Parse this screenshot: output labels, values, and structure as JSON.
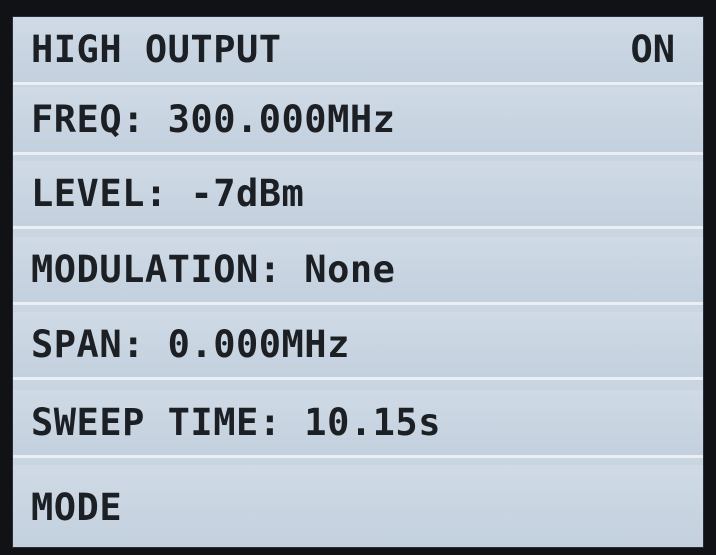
{
  "menu": {
    "rows": [
      {
        "label": "HIGH OUTPUT",
        "state": "ON"
      },
      {
        "label": "FREQ: 300.000MHz"
      },
      {
        "label": "LEVEL: -7dBm"
      },
      {
        "label": "MODULATION: None"
      },
      {
        "label": "SPAN: 0.000MHz"
      },
      {
        "label": "SWEEP TIME: 10.15s"
      },
      {
        "label": "MODE"
      }
    ]
  },
  "colors": {
    "screen_background": "#c9d5e1",
    "row_separator": "#e9eff5",
    "text": "#1c1f24",
    "bezel": "#111216"
  }
}
